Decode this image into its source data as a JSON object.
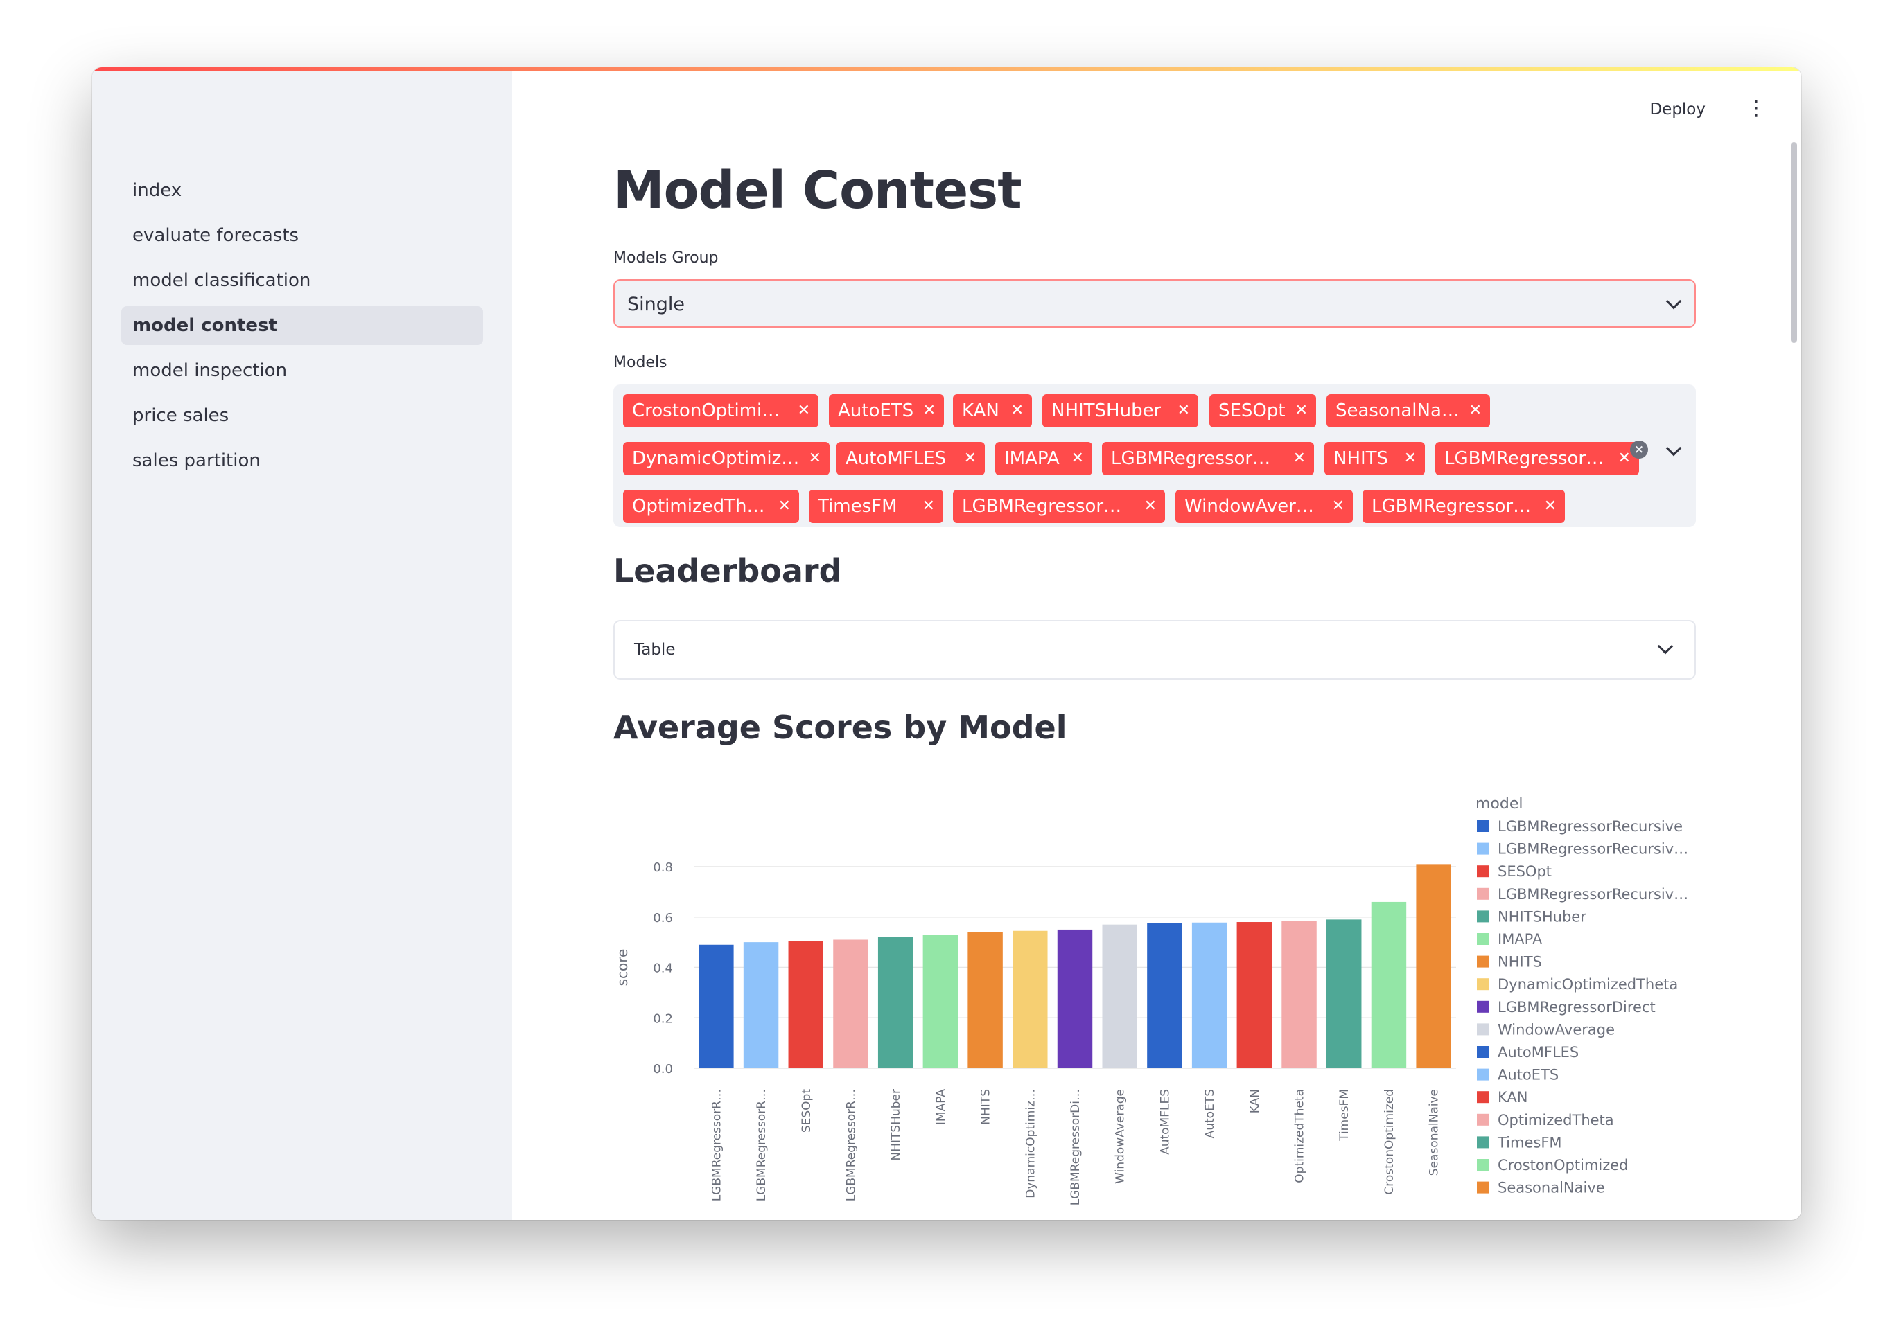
{
  "sidebar": {
    "items": [
      {
        "label": "index",
        "active": false
      },
      {
        "label": "evaluate forecasts",
        "active": false
      },
      {
        "label": "model classification",
        "active": false
      },
      {
        "label": "model contest",
        "active": true
      },
      {
        "label": "model inspection",
        "active": false
      },
      {
        "label": "price sales",
        "active": false
      },
      {
        "label": "sales partition",
        "active": false
      }
    ]
  },
  "header": {
    "deploy_label": "Deploy"
  },
  "page": {
    "title": "Model Contest"
  },
  "models_group": {
    "label": "Models Group",
    "value": "Single"
  },
  "models": {
    "label": "Models",
    "chips": [
      "CrostonOptimized",
      "AutoETS",
      "KAN",
      "NHITSHuber",
      "SESOpt",
      "SeasonalNaive",
      "DynamicOptimiz…",
      "AutoMFLES",
      "IMAPA",
      "LGBMRegressor…",
      "NHITS",
      "LGBMRegressor…",
      "OptimizedTheta",
      "TimesFM",
      "LGBMRegressor…",
      "WindowAverage",
      "LGBMRegressor…"
    ]
  },
  "leaderboard": {
    "heading": "Leaderboard",
    "expander_label": "Table"
  },
  "chart_section": {
    "heading": "Average Scores by Model"
  },
  "chart_data": {
    "type": "bar",
    "xlabel": "model",
    "ylabel": "score",
    "ylim": [
      0,
      0.8
    ],
    "yticks": [
      0.0,
      0.2,
      0.4,
      0.6,
      0.8
    ],
    "ytick_labels": [
      "0.0",
      "0.2",
      "0.4",
      "0.6",
      "0.8"
    ],
    "grid": true,
    "legend_title": "model",
    "legend_position": "right",
    "categories": [
      "LGBMRegressorR…",
      "LGBMRegressorR…",
      "SESOpt",
      "LGBMRegressorR…",
      "NHITSHuber",
      "IMAPA",
      "NHITS",
      "DynamicOptimiz…",
      "LGBMRegressorDi…",
      "WindowAverage",
      "AutoMFLES",
      "AutoETS",
      "KAN",
      "OptimizedTheta",
      "TimesFM",
      "CrostonOptimized",
      "SeasonalNaive"
    ],
    "legend_labels": [
      "LGBMRegressorRecursive",
      "LGBMRegressorRecursiv…",
      "SESOpt",
      "LGBMRegressorRecursiv…",
      "NHITSHuber",
      "IMAPA",
      "NHITS",
      "DynamicOptimizedTheta",
      "LGBMRegressorDirect",
      "WindowAverage",
      "AutoMFLES",
      "AutoETS",
      "KAN",
      "OptimizedTheta",
      "TimesFM",
      "CrostonOptimized",
      "SeasonalNaive"
    ],
    "values": [
      0.49,
      0.5,
      0.505,
      0.51,
      0.52,
      0.53,
      0.54,
      0.545,
      0.55,
      0.57,
      0.575,
      0.578,
      0.58,
      0.585,
      0.59,
      0.66,
      0.81
    ],
    "colors": [
      "#2c65c9",
      "#8ec2fa",
      "#e8423a",
      "#f3aaaa",
      "#4fa896",
      "#93e6a6",
      "#ec8a34",
      "#f6cf72",
      "#673ab7",
      "#d3d7e0",
      "#2c65c9",
      "#8ec2fa",
      "#e8423a",
      "#f3aaaa",
      "#4fa896",
      "#93e6a6",
      "#ec8a34"
    ]
  }
}
